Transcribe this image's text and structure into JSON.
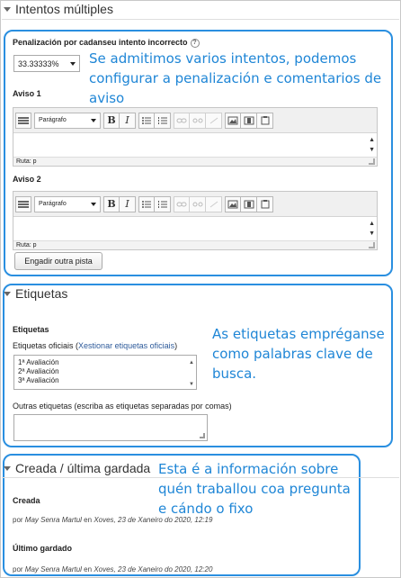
{
  "sections": {
    "multiple_tries": {
      "title": "Intentos múltiples"
    },
    "tags": {
      "title": "Etiquetas"
    },
    "created": {
      "title": "Creada / última gardada"
    }
  },
  "penalty": {
    "label": "Penalización por cadanseu intento incorrecto",
    "help_symbol": "?",
    "value": "33.33333%"
  },
  "hints": [
    {
      "label": "Aviso 1",
      "format_select": "Parágrafo",
      "path_label": "Ruta: p"
    },
    {
      "label": "Aviso 2",
      "format_select": "Parágrafo",
      "path_label": "Ruta: p"
    }
  ],
  "toolbar": {
    "bold": "B",
    "italic": "I",
    "scroll_up": "▲",
    "scroll_down": "▼"
  },
  "add_hint_button": "Engadir outra pista",
  "tags": {
    "heading": "Etiquetas",
    "official_label": "Etiquetas oficiais",
    "manage_link": "Xestionar etiquetas oficiais",
    "official_options": [
      "1ª Avaliación",
      "2ª Avaliación",
      "3ª Avaliación"
    ],
    "other_label": "Outras etiquetas (escriba as etiquetas separadas por comas)"
  },
  "created": {
    "created_heading": "Creada",
    "created_prefix": "por",
    "created_author": "May Senra Martul",
    "created_in": "en",
    "created_date": "Xoves, 23 de Xaneiro do 2020, 12:19",
    "saved_heading": "Último gardado",
    "saved_prefix": "por",
    "saved_author": "May Senra Martul",
    "saved_in": "en",
    "saved_date": "Xoves, 23 de Xaneiro do 2020, 12:20"
  },
  "annotations": {
    "tries": "Se admitimos varios intentos, podemos configurar a penalización e comentarios de aviso",
    "tags": "As etiquetas empréganse como palabras clave de busca.",
    "created": "Esta é a información sobre quén traballou coa pregunta e cándo o fixo"
  },
  "colors": {
    "callout": "#2a8fe0",
    "annotation_text": "#1f86d6",
    "link": "#2d5a9a"
  },
  "icons": [
    "collapse-triangle-icon",
    "help-icon",
    "toolbar-toggle-icon",
    "bullet-list-icon",
    "numbered-list-icon",
    "link-icon",
    "unlink-icon",
    "no-link-icon",
    "image-icon",
    "media-icon",
    "paste-icon",
    "resize-grip-icon"
  ]
}
